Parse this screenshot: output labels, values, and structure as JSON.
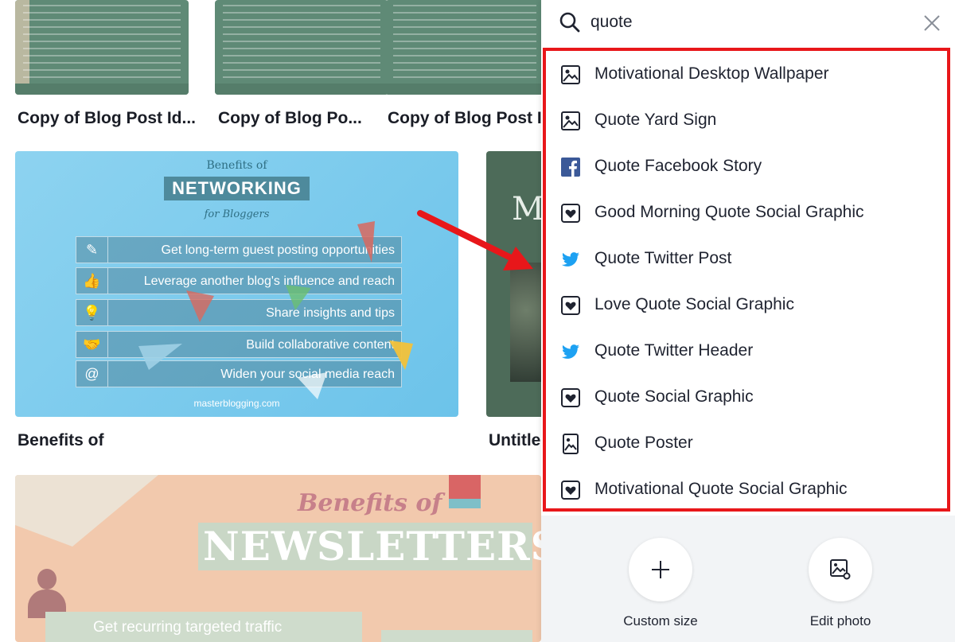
{
  "grid": {
    "cards": [
      {
        "title": "Copy of Blog Post Id..."
      },
      {
        "title": "Copy of Blog Po..."
      },
      {
        "title": "Copy of Blog Post Id"
      },
      {
        "title": "Benefits of"
      },
      {
        "title": "Untitle"
      }
    ],
    "networking_card": {
      "kicker": "Benefits of",
      "banner": "NETWORKING",
      "subtitle": "for Bloggers",
      "rows": [
        "Get long-term guest posting opportunities",
        "Leverage another blog's influence and reach",
        "Share insights and tips",
        "Build collaborative content",
        "Widen your social media reach"
      ],
      "footer": "masterblogging.com"
    },
    "untitled_card": {
      "letter": "M"
    },
    "newsletters_card": {
      "kicker": "Benefits of",
      "banner": "NEWSLETTERS",
      "strip": "Get recurring targeted traffic"
    }
  },
  "search": {
    "value": "quote",
    "results": [
      {
        "label": "Motivational Desktop Wallpaper",
        "icon": "image-icon"
      },
      {
        "label": "Quote Yard Sign",
        "icon": "image-icon"
      },
      {
        "label": "Quote Facebook Story",
        "icon": "facebook-icon"
      },
      {
        "label": "Good Morning Quote Social Graphic",
        "icon": "heart-icon"
      },
      {
        "label": "Quote Twitter Post",
        "icon": "twitter-icon"
      },
      {
        "label": "Love Quote Social Graphic",
        "icon": "heart-icon"
      },
      {
        "label": "Quote Twitter Header",
        "icon": "twitter-icon"
      },
      {
        "label": "Quote Social Graphic",
        "icon": "heart-icon"
      },
      {
        "label": "Quote Poster",
        "icon": "poster-icon"
      },
      {
        "label": "Motivational Quote Social Graphic",
        "icon": "heart-icon"
      }
    ]
  },
  "actions": {
    "custom_size": "Custom size",
    "edit_photo": "Edit photo"
  },
  "colors": {
    "highlight_red": "#e8171a",
    "facebook_blue": "#3b5998",
    "twitter_blue": "#1da1f2"
  }
}
